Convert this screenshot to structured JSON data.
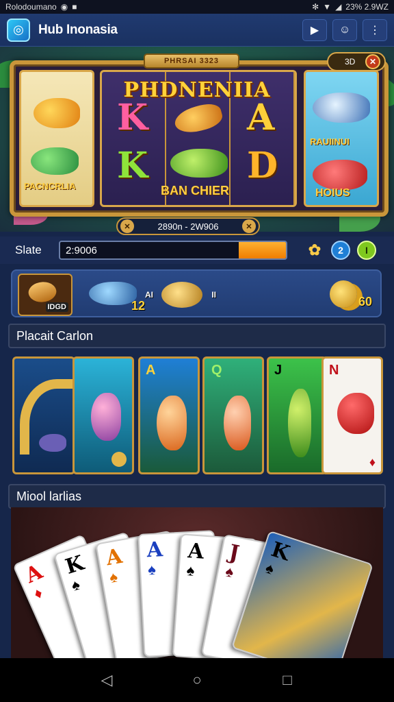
{
  "status_bar": {
    "left_text": "Rolodoumano",
    "right_text": "23% 2.9WZ"
  },
  "app": {
    "title": "Hub Inonasia"
  },
  "hero": {
    "board_title": "PHRSAI 3323",
    "big_title": "PHDNENIIA",
    "left_label": "PACNCRLIA",
    "mid_label": "BAN CHIER",
    "right_top_label": "RAUIINUI",
    "right_bottom_label": "HOIUS",
    "corner_value": "3D",
    "range": "2890n - 2W906",
    "symbols": {
      "k1": "K",
      "a1": "A",
      "k2": "K",
      "d1": "D"
    }
  },
  "state": {
    "label": "Slate",
    "value": "2:9006",
    "fill_fraction": 0.21,
    "badge_2": "2",
    "badge_1": "I"
  },
  "items": {
    "item1_badge": "IDGD",
    "item2_badge": "12",
    "item3_badge_left": "AI",
    "item3_badge_right": "II",
    "item4_badge": "60"
  },
  "sections": {
    "section1": "Placait Carlon",
    "section2": "Miool larlias"
  },
  "game_cards": [
    {
      "corner": ""
    },
    {
      "corner": ""
    },
    {
      "corner": "A"
    },
    {
      "corner": "Q"
    },
    {
      "corner": "J"
    },
    {
      "corner": "N"
    }
  ],
  "poker_cards": [
    {
      "rank": "A",
      "suit": "♦",
      "color": "#d11"
    },
    {
      "rank": "K",
      "suit": "♠",
      "color": "#000"
    },
    {
      "rank": "A",
      "suit": "♠",
      "color": "#e27100"
    },
    {
      "rank": "A",
      "suit": "♠",
      "color": "#1a3fbf"
    },
    {
      "rank": "A",
      "suit": "♠",
      "color": "#000"
    },
    {
      "rank": "J",
      "suit": "♠",
      "color": "#6b0a1a"
    },
    {
      "rank": "K",
      "suit": "♠",
      "color": "#000"
    }
  ],
  "colors": {
    "accent": "#f07d00",
    "gold": "#c9963a",
    "appbar": "#1a3161"
  },
  "icons": [
    "logo-icon",
    "camera-icon",
    "user-icon",
    "more-vert-icon",
    "back-icon",
    "home-icon",
    "recents-icon"
  ]
}
